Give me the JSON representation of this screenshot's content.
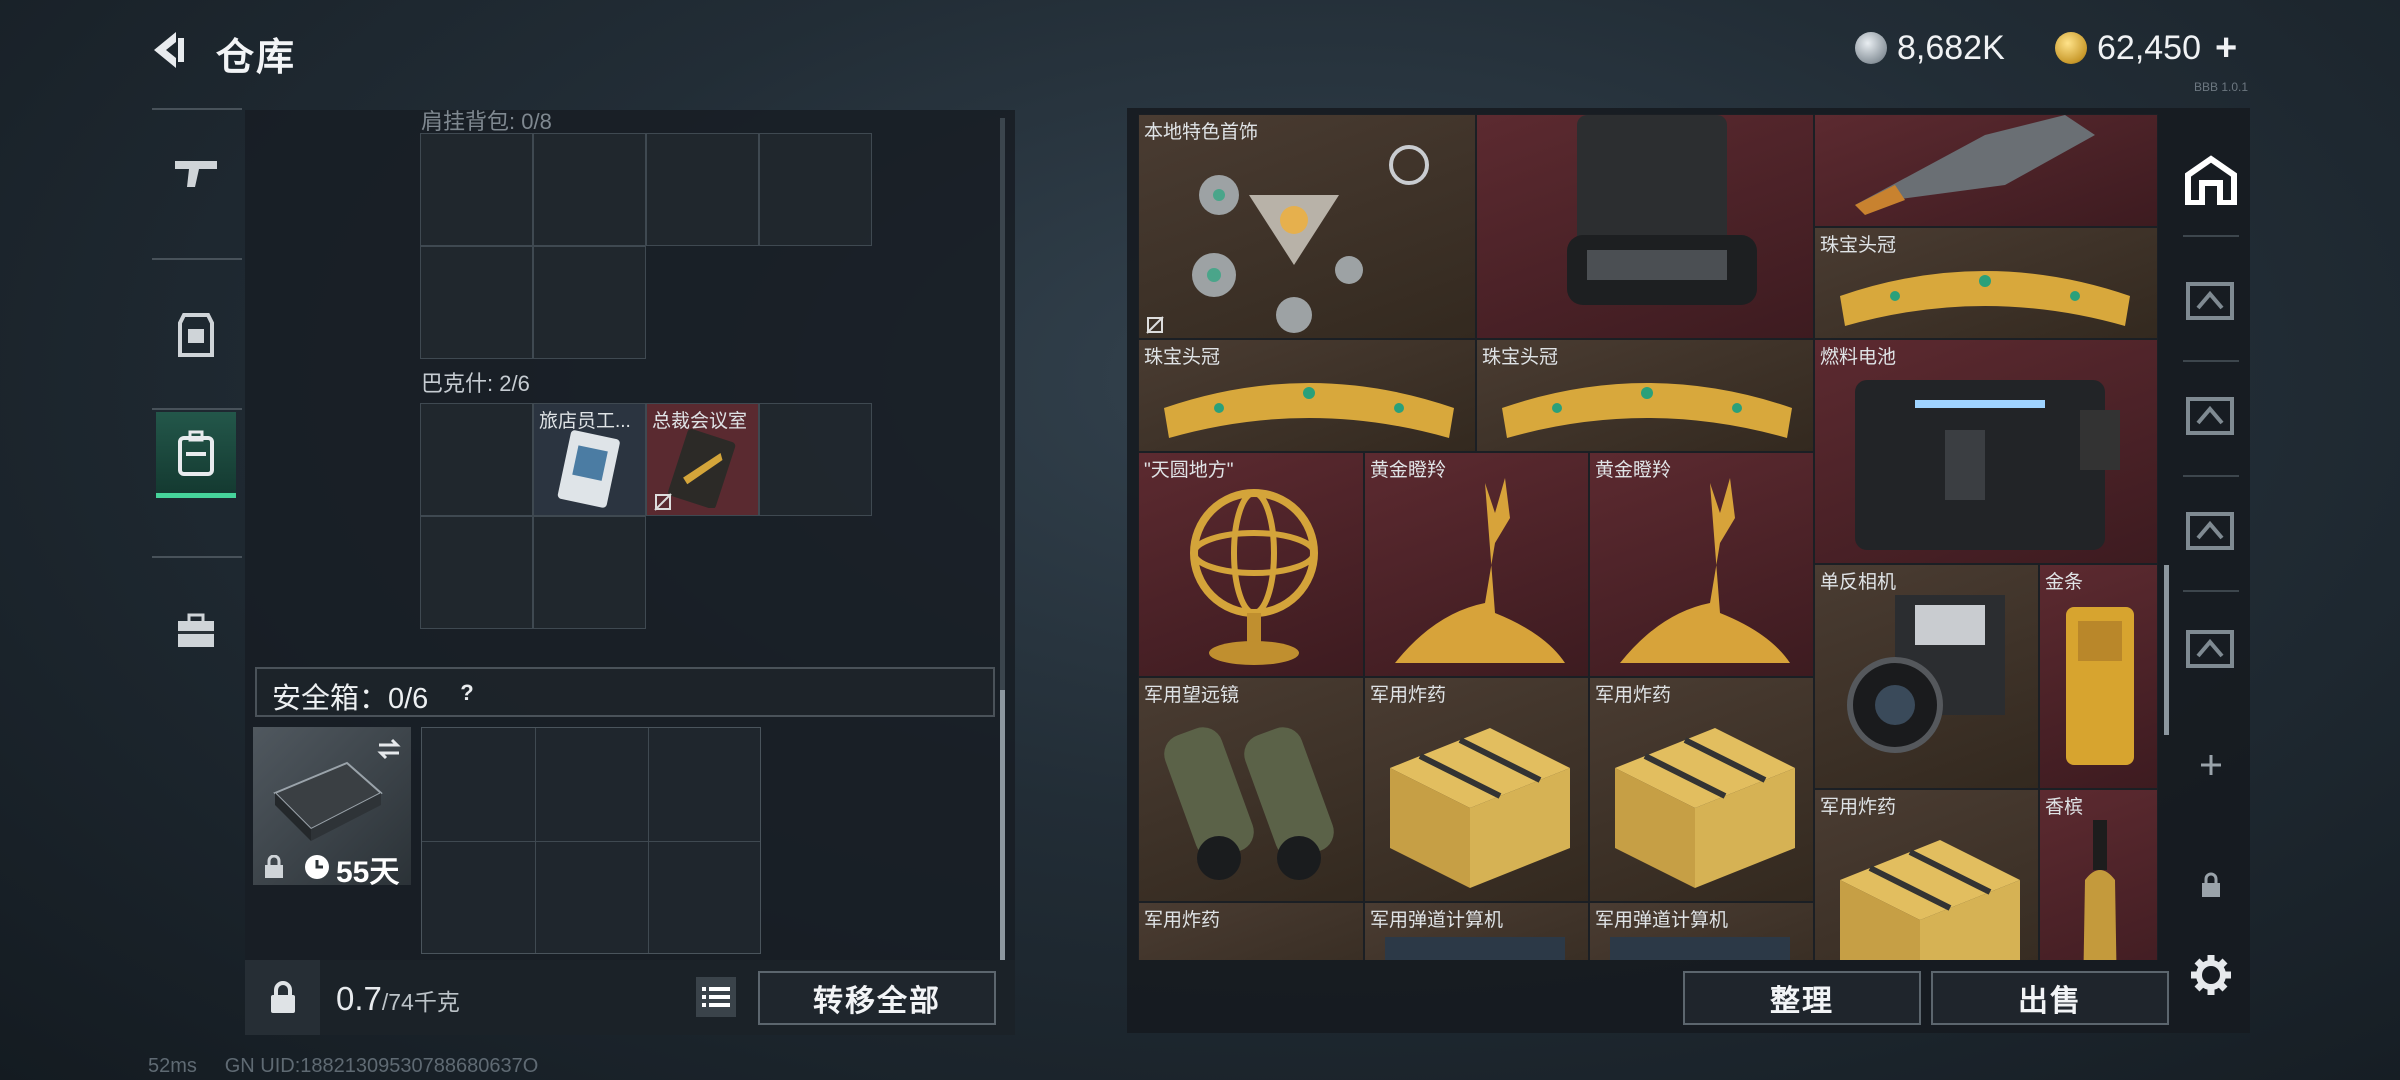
{
  "header": {
    "title": "仓库",
    "currency_silver": "8,682K",
    "currency_gold": "62,450",
    "add_label": "+",
    "version_text": "BBB 1.0.1"
  },
  "left_nav": {
    "items": [
      "weapon",
      "armor",
      "backpack",
      "case"
    ],
    "active_index": 2
  },
  "inventory": {
    "section1_label": "肩挂背包: 0/8",
    "section2_label": "巴克什: 2/6",
    "items": [
      {
        "label": "旅店员工...",
        "color": "#2b3440"
      },
      {
        "label": "总裁会议室",
        "color": "#5a2a30"
      }
    ],
    "safe_label": "安全箱：0/6",
    "safe_help": "?",
    "safe_days": "55天",
    "weight_value": "0.7",
    "weight_unit": "/74千克",
    "transfer_all": "转移全部"
  },
  "stash": {
    "items": [
      {
        "label": "本地特色首饰",
        "bg": "brown"
      },
      {
        "label": "",
        "bg": "red"
      },
      {
        "label": "",
        "bg": "red"
      },
      {
        "label": "珠宝头冠",
        "bg": "brown"
      },
      {
        "label": "珠宝头冠",
        "bg": "brown"
      },
      {
        "label": "珠宝头冠",
        "bg": "brown"
      },
      {
        "label": "燃料电池",
        "bg": "red"
      },
      {
        "label": "\"天圆地方\"",
        "bg": "red"
      },
      {
        "label": "黄金瞪羚",
        "bg": "red"
      },
      {
        "label": "黄金瞪羚",
        "bg": "red"
      },
      {
        "label": "单反相机",
        "bg": "brown"
      },
      {
        "label": "金条",
        "bg": "red"
      },
      {
        "label": "军用望远镜",
        "bg": "brown"
      },
      {
        "label": "军用炸药",
        "bg": "brown"
      },
      {
        "label": "军用炸药",
        "bg": "brown"
      },
      {
        "label": "军用炸药",
        "bg": "brown"
      },
      {
        "label": "香槟",
        "bg": "red"
      },
      {
        "label": "军用炸药",
        "bg": "brown"
      },
      {
        "label": "军用弹道计算机",
        "bg": "brown"
      },
      {
        "label": "军用弹道计算机",
        "bg": "brown"
      }
    ],
    "sort_label": "整理",
    "sell_label": "出售"
  },
  "right_nav": {
    "items": [
      "stash-home",
      "stash-4",
      "stash-2",
      "stash-3",
      "stash-1",
      "add",
      "lock",
      "settings"
    ]
  },
  "status_bar": {
    "ping": "52ms",
    "uid": "GN UID:18821309530788680637O"
  }
}
